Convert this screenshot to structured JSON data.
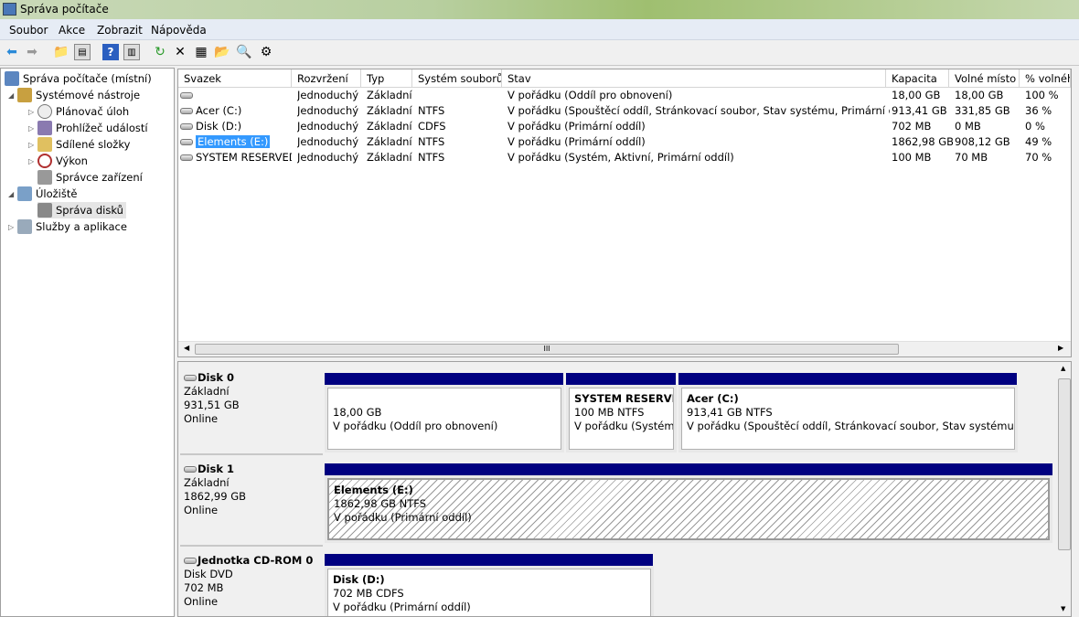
{
  "window": {
    "title": "Správa počítače"
  },
  "menu": [
    "Soubor",
    "Akce",
    "Zobrazit",
    "Nápověda"
  ],
  "toolbar": [
    "back-icon",
    "forward-icon",
    "up-folder-icon",
    "show-hide-tree-icon",
    "help-icon",
    "show-hide-action-pane-icon",
    "refresh-icon",
    "delete-icon",
    "properties-icon",
    "open-icon",
    "search-icon",
    "settings-icon"
  ],
  "tree": {
    "root": "Správa počítače (místní)",
    "system_tools": "Systémové nástroje",
    "task_scheduler": "Plánovač úloh",
    "event_viewer": "Prohlížeč událostí",
    "shared_folders": "Sdílené složky",
    "performance": "Výkon",
    "device_manager": "Správce zařízení",
    "storage": "Úložiště",
    "disk_management": "Správa disků",
    "services": "Služby a aplikace"
  },
  "list": {
    "columns": [
      "Svazek",
      "Rozvržení",
      "Typ",
      "Systém souborů",
      "Stav",
      "Kapacita",
      "Volné místo",
      "% volného"
    ],
    "rows": [
      [
        "",
        "Jednoduchý",
        "Základní",
        "",
        "V pořádku (Oddíl pro obnovení)",
        "18,00 GB",
        "18,00 GB",
        "100 %"
      ],
      [
        "Acer (C:)",
        "Jednoduchý",
        "Základní",
        "NTFS",
        "V pořádku (Spouštěcí oddíl, Stránkovací soubor, Stav systému, Primární oddíl)",
        "913,41 GB",
        "331,85 GB",
        "36 %"
      ],
      [
        "Disk (D:)",
        "Jednoduchý",
        "Základní",
        "CDFS",
        "V pořádku (Primární oddíl)",
        "702 MB",
        "0 MB",
        "0 %"
      ],
      [
        "Elements (E:)",
        "Jednoduchý",
        "Základní",
        "NTFS",
        "V pořádku (Primární oddíl)",
        "1862,98 GB",
        "908,12 GB",
        "49 %"
      ],
      [
        "SYSTEM RESERVED",
        "Jednoduchý",
        "Základní",
        "NTFS",
        "V pořádku (Systém, Aktivní, Primární oddíl)",
        "100 MB",
        "70 MB",
        "70 %"
      ]
    ],
    "selected_row": 3,
    "hscroll_grip": "III"
  },
  "disks": [
    {
      "name": "Disk 0",
      "type": "Základní",
      "size": "931,51 GB",
      "status": "Online",
      "partitions": [
        {
          "title": "",
          "size": "18,00 GB",
          "status": "V pořádku (Oddíl pro obnovení)"
        },
        {
          "title": "SYSTEM RESERVED",
          "size": "100 MB NTFS",
          "status": "V pořádku (Systém, A"
        },
        {
          "title": "Acer  (C:)",
          "size": "913,41 GB NTFS",
          "status": "V pořádku (Spouštěcí oddíl, Stránkovací soubor, Stav systému, Prim"
        }
      ]
    },
    {
      "name": "Disk 1",
      "type": "Základní",
      "size": "1862,99 GB",
      "status": "Online",
      "partitions": [
        {
          "title": "Elements  (E:)",
          "size": "1862,98 GB NTFS",
          "status": "V pořádku (Primární oddíl)"
        }
      ]
    },
    {
      "name": "Jednotka CD-ROM 0",
      "type": "Disk DVD",
      "size": "702 MB",
      "status": "Online",
      "partitions": [
        {
          "title": "Disk  (D:)",
          "size": "702 MB CDFS",
          "status": "V pořádku (Primární oddíl)"
        }
      ]
    }
  ],
  "colors": {
    "partition_bar": "#000080",
    "selection": "#3399ff"
  }
}
